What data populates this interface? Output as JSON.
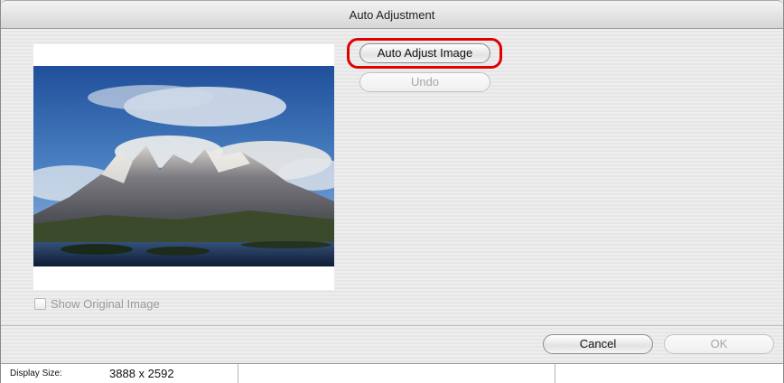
{
  "window": {
    "title": "Auto Adjustment"
  },
  "buttons": {
    "auto_adjust": "Auto Adjust Image",
    "undo": "Undo",
    "cancel": "Cancel",
    "ok": "OK"
  },
  "checkbox": {
    "show_original_label": "Show Original Image",
    "checked": false
  },
  "status": {
    "display_size_label": "Display Size:",
    "display_size_value": "3888 x 2592"
  },
  "colors": {
    "highlight": "#e00000",
    "sky": "#2f63a6",
    "water": "#1d3557"
  }
}
